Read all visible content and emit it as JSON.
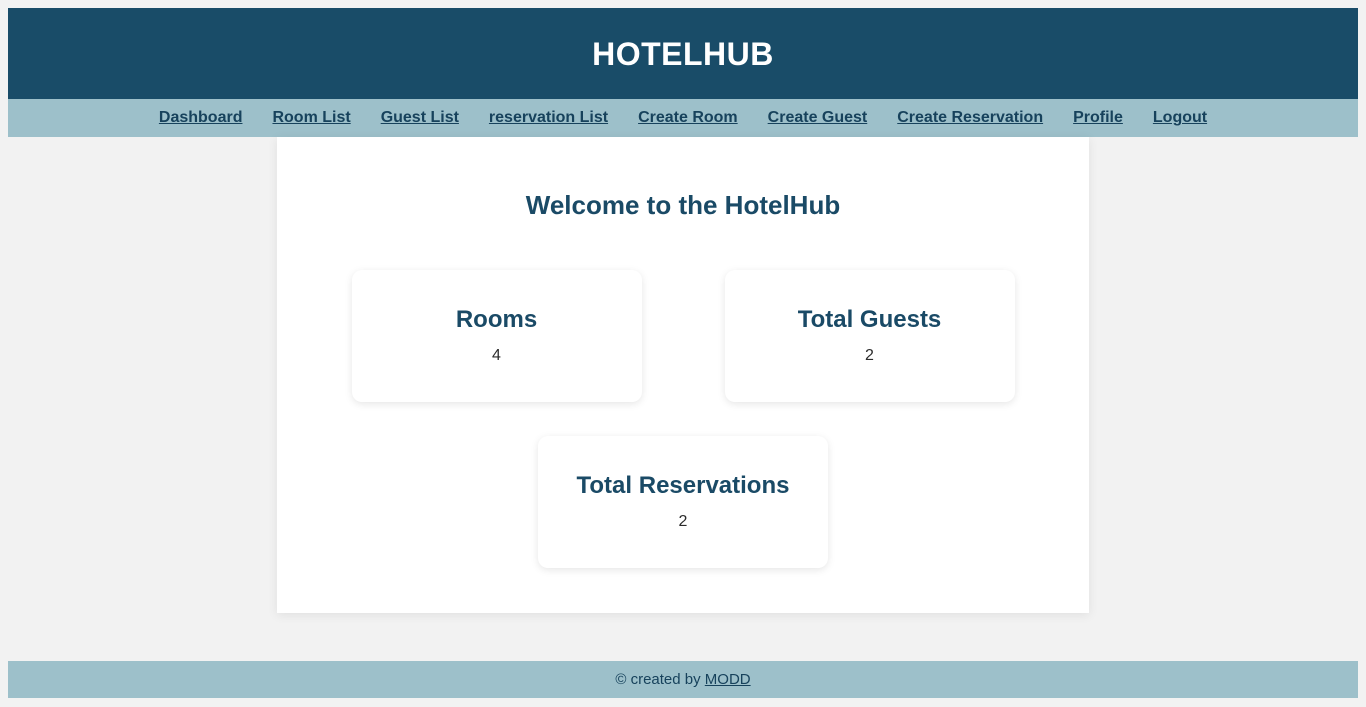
{
  "header": {
    "title": "HOTELHUB",
    "background_color": "#194c68",
    "title_color": "#ffffff"
  },
  "nav": {
    "background_color": "#9dc0ca",
    "link_color": "#17425c",
    "items": [
      {
        "label": "Dashboard",
        "name": "nav-link-dashboard"
      },
      {
        "label": "Room List",
        "name": "nav-link-room-list"
      },
      {
        "label": "Guest List",
        "name": "nav-link-guest-list"
      },
      {
        "label": "reservation List",
        "name": "nav-link-reservation-list"
      },
      {
        "label": "Create Room",
        "name": "nav-link-create-room"
      },
      {
        "label": "Create Guest",
        "name": "nav-link-create-guest"
      },
      {
        "label": "Create Reservation",
        "name": "nav-link-create-reservation"
      },
      {
        "label": "Profile",
        "name": "nav-link-profile"
      },
      {
        "label": "Logout",
        "name": "nav-link-logout"
      }
    ]
  },
  "main": {
    "welcome_title": "Welcome to the HotelHub",
    "accent_color": "#1a4a66",
    "stats": [
      {
        "title": "Rooms",
        "value": "4"
      },
      {
        "title": "Total Guests",
        "value": "2"
      },
      {
        "title": "Total Reservations",
        "value": "2"
      }
    ]
  },
  "footer": {
    "background_color": "#9dc0ca",
    "copyright": "© created by",
    "link_label": "MODD"
  }
}
